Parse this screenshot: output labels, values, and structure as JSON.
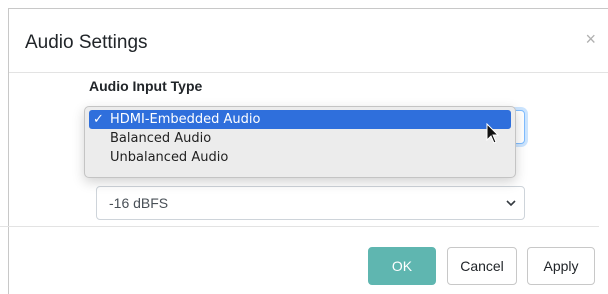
{
  "modal": {
    "title": "Audio Settings",
    "close_symbol": "×"
  },
  "form": {
    "audio_input_type_label": "Audio Input Type",
    "audio_input_type_options": [
      {
        "label": "HDMI-Embedded Audio",
        "selected": true
      },
      {
        "label": "Balanced Audio",
        "selected": false
      },
      {
        "label": "Unbalanced Audio",
        "selected": false
      }
    ],
    "check_mark": "✓",
    "level_value": "-16 dBFS"
  },
  "footer": {
    "ok_label": "OK",
    "cancel_label": "Cancel",
    "apply_label": "Apply"
  },
  "colors": {
    "ok_button": "#5fb6b0",
    "selected_option": "#2f6fdc",
    "focus_ring": "#80bdff"
  },
  "icons": {
    "close": "close-icon",
    "chevron": "chevron-down-icon",
    "cursor": "mouse-pointer-icon"
  }
}
